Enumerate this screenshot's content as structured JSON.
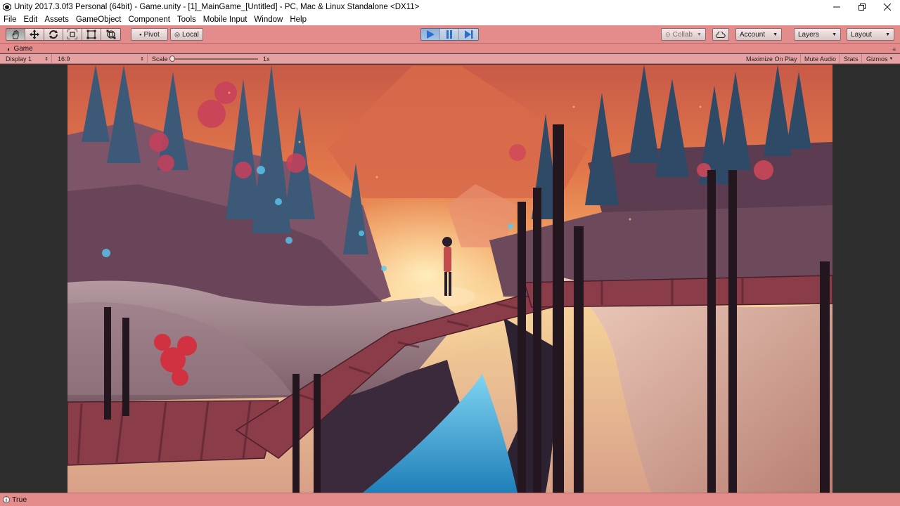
{
  "window": {
    "title": "Unity 2017.3.0f3 Personal (64bit) - Game.unity - [1]_MainGame_[Untitled] - PC, Mac & Linux Standalone <DX11>",
    "controls": [
      "minimize-icon",
      "restore-icon",
      "close-icon"
    ]
  },
  "menu": {
    "items": [
      "File",
      "Edit",
      "Assets",
      "GameObject",
      "Component",
      "Tools",
      "Mobile Input",
      "Window",
      "Help"
    ]
  },
  "toolbar": {
    "tools": [
      "hand-tool-icon",
      "move-tool-icon",
      "rotate-tool-icon",
      "scale-tool-icon",
      "rect-tool-icon",
      "transform-tool-icon"
    ],
    "pivot_label": "Pivot",
    "local_label": "Local",
    "collab_label": "Collab",
    "account_label": "Account",
    "layers_label": "Layers",
    "layout_label": "Layout",
    "play_state": "playing"
  },
  "game_view": {
    "tab_label": "Game",
    "display": "Display 1",
    "aspect": "16:9",
    "scale_label": "Scale",
    "scale_value": "1x",
    "maximize_label": "Maximize On Play",
    "mute_label": "Mute Audio",
    "stats_label": "Stats",
    "gizmos_label": "Gizmos"
  },
  "status": {
    "text": "True"
  },
  "colors": {
    "editor_tint": "#e48c8c",
    "play_accent": "#4a8ad8",
    "sky_orange": "#e2774a",
    "water_blue": "#3aa8d8"
  }
}
